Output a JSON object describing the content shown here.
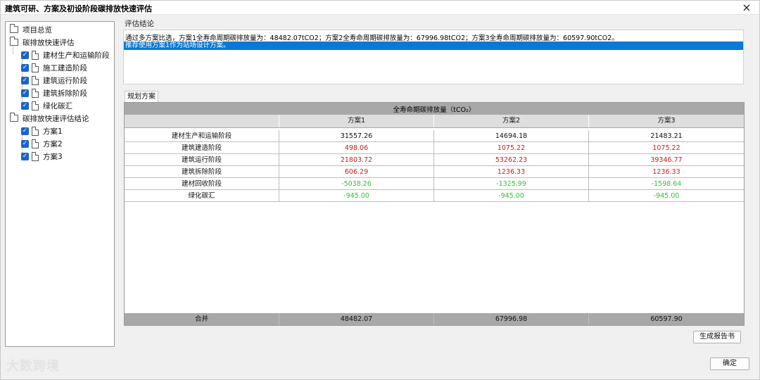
{
  "window": {
    "title": "建筑可研、方案及初设阶段碳排放快速评估",
    "close_icon": "×"
  },
  "tree": {
    "items": [
      {
        "label": "项目总览",
        "type": "folder"
      },
      {
        "label": "碳排放快速评估",
        "type": "folder"
      },
      {
        "label": "建材生产和运输阶段",
        "type": "doc",
        "checked": true
      },
      {
        "label": "施工建造阶段",
        "type": "doc",
        "checked": true
      },
      {
        "label": "建筑运行阶段",
        "type": "doc",
        "checked": true
      },
      {
        "label": "建筑拆除阶段",
        "type": "doc",
        "checked": true
      },
      {
        "label": "绿化碳汇",
        "type": "doc",
        "checked": true
      },
      {
        "label": "碳排放快速评估结论",
        "type": "folder"
      },
      {
        "label": "方案1",
        "type": "doc",
        "checked": true
      },
      {
        "label": "方案2",
        "type": "doc",
        "checked": true
      },
      {
        "label": "方案3",
        "type": "doc",
        "checked": true
      }
    ],
    "checkmark": "✓"
  },
  "conclusion": {
    "label": "评估结论",
    "line1": "通过多方案比选，方案1全寿命周期碳排放量为：48482.07tCO2；方案2全寿命周期碳排放量为：67996.98tCO2；方案3全寿命周期碳排放量为：60597.90tCO2。",
    "line2": "推荐使用方案1作为站场设计方案。"
  },
  "tab": {
    "label": "规划方案"
  },
  "table": {
    "title": "全寿命期碳排放量（tCO₂）",
    "columns": [
      "",
      "方案1",
      "方案2",
      "方案3"
    ],
    "rows": [
      {
        "label": "建材生产和运输阶段",
        "values": [
          "31557.26",
          "14694.18",
          "21483.21"
        ],
        "tone": "black"
      },
      {
        "label": "建筑建造阶段",
        "values": [
          "498.06",
          "1075.22",
          "1075.22"
        ],
        "tone": "red"
      },
      {
        "label": "建筑运行阶段",
        "values": [
          "21803.72",
          "53262.23",
          "39346.77"
        ],
        "tone": "red"
      },
      {
        "label": "建筑拆除阶段",
        "values": [
          "606.29",
          "1236.33",
          "1236.33"
        ],
        "tone": "red"
      },
      {
        "label": "建材回收阶段",
        "values": [
          "-5038.26",
          "-1325.99",
          "-1598.64"
        ],
        "tone": "green"
      },
      {
        "label": "绿化碳汇",
        "values": [
          "-945.00",
          "-945.00",
          "-945.00"
        ],
        "tone": "green"
      }
    ],
    "total": {
      "label": "合并",
      "values": [
        "48482.07",
        "67996.98",
        "60597.90"
      ]
    }
  },
  "buttons": {
    "report": "生成报告书",
    "ok": "确定"
  },
  "watermark": "大数跨境",
  "colors": {
    "red": "#c8211f",
    "green": "#2fc42f",
    "selection": "#0a78d7",
    "checkbox": "#1a64c8"
  }
}
